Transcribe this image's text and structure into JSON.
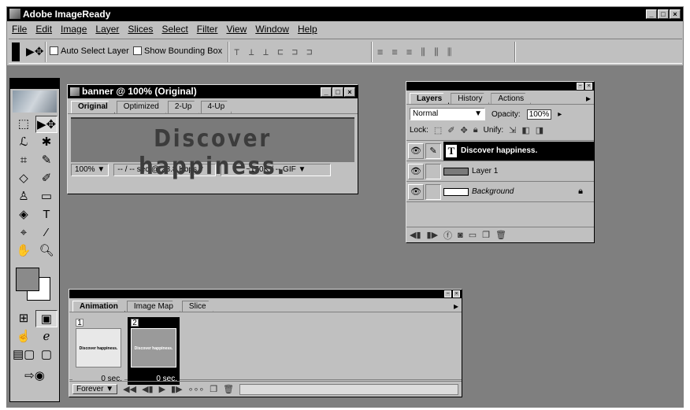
{
  "app": {
    "title": "Adobe ImageReady",
    "window_buttons": [
      "_",
      "□",
      "×"
    ]
  },
  "menu": [
    "File",
    "Edit",
    "Image",
    "Layer",
    "Slices",
    "Select",
    "Filter",
    "View",
    "Window",
    "Help"
  ],
  "options_bar": {
    "auto_select_label": "Auto Select Layer",
    "show_bbox_label": "Show Bounding Box",
    "align_group1": "⊤ ⊥ ⊥ ⊏ ⊐ ⊐",
    "align_group2": "≡ ≡ ≡ ⫼ ⫼ ⫼"
  },
  "document": {
    "title": "banner @ 100% (Original)",
    "tabs": [
      "Original",
      "Optimized",
      "2-Up",
      "4-Up"
    ],
    "active_tab": "Original",
    "canvas_text": "Discover happiness.",
    "zoom": "100%",
    "download_time": "-- / -- sec @ 28.8 Kbps",
    "file_size": "~150K / -- GIF",
    "window_buttons": [
      "_",
      "□",
      "×"
    ]
  },
  "layers_palette": {
    "tabs": [
      "Layers",
      "History",
      "Actions"
    ],
    "active_tab": "Layers",
    "blend_mode": "Normal",
    "opacity_label": "Opacity:",
    "opacity": "100%",
    "lock_label": "Lock:",
    "unify_label": "Unify:",
    "layers": [
      {
        "name": "Discover happiness.",
        "kind": "text"
      },
      {
        "name": "Layer 1",
        "kind": "pixel"
      },
      {
        "name": "Background",
        "kind": "background"
      }
    ]
  },
  "animation_palette": {
    "tabs": [
      "Animation",
      "Image Map",
      "Slice"
    ],
    "active_tab": "Animation",
    "frames": [
      {
        "number": "1",
        "delay": "0 sec.",
        "thumb_text": "Discover happiness."
      },
      {
        "number": "2",
        "delay": "0 sec.",
        "thumb_text": "Discover happiness."
      }
    ],
    "loop": "Forever"
  },
  "colors": {
    "foreground": "#8a8a8a",
    "background": "#ffffff",
    "workspace": "#7f7f7f"
  }
}
